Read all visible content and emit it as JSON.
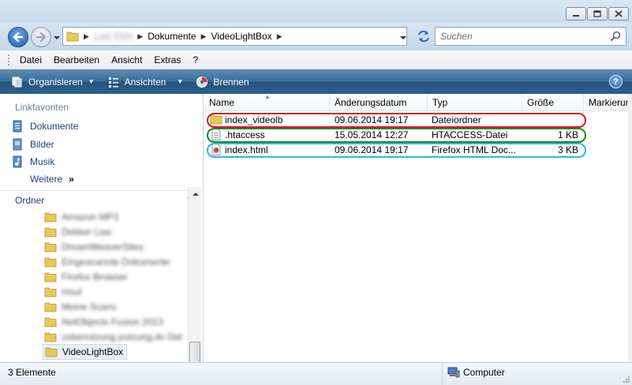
{
  "window": {
    "controls": [
      "minimize",
      "maximize",
      "close"
    ]
  },
  "address": {
    "crumbs": [
      "Lutz Eich",
      "Dokumente",
      "VideoLightBox"
    ],
    "search_placeholder": "Suchen"
  },
  "menu": {
    "items": [
      "Datei",
      "Bearbeiten",
      "Ansicht",
      "Extras",
      "?"
    ]
  },
  "commands": {
    "organize": "Organisieren",
    "views": "Ansichten",
    "burn": "Brennen",
    "help": "?"
  },
  "nav": {
    "favorites_title": "Linkfavoriten",
    "links": [
      "Dokumente",
      "Bilder",
      "Musik"
    ],
    "more": "Weitere",
    "more_chevron": "»",
    "folders_title": "Ordner",
    "tree": [
      "Amazon MP3",
      "Dekker Lise",
      "DreamWeaverSites",
      "Eingescannte Dokumente",
      "Firefox Browser",
      "Houf",
      "Meine Scans",
      "NetObjects Fusion 2013",
      "usbenutzung putzung.dv Dat",
      "VideoLightBox"
    ]
  },
  "files": {
    "columns": [
      "Name",
      "Änderungsdatum",
      "Typ",
      "Größe",
      "Markierungen"
    ],
    "rows": [
      {
        "name": "index_videolb",
        "date": "09.06.2014 19:17",
        "type": "Dateiordner",
        "size": "",
        "icon": "folder-icon",
        "outline": "#e0101c"
      },
      {
        "name": ".htaccess",
        "date": "15.05.2014 12:27",
        "type": "HTACCESS-Datei",
        "size": "1 KB",
        "icon": "text-file-icon",
        "outline": "#1b8a1b"
      },
      {
        "name": "index.html",
        "date": "09.06.2014 19:17",
        "type": "Firefox HTML Doc...",
        "size": "3 KB",
        "icon": "firefox-html-icon",
        "outline": "#30b6e0"
      }
    ]
  },
  "status": {
    "count": "3 Elemente",
    "location": "Computer"
  }
}
